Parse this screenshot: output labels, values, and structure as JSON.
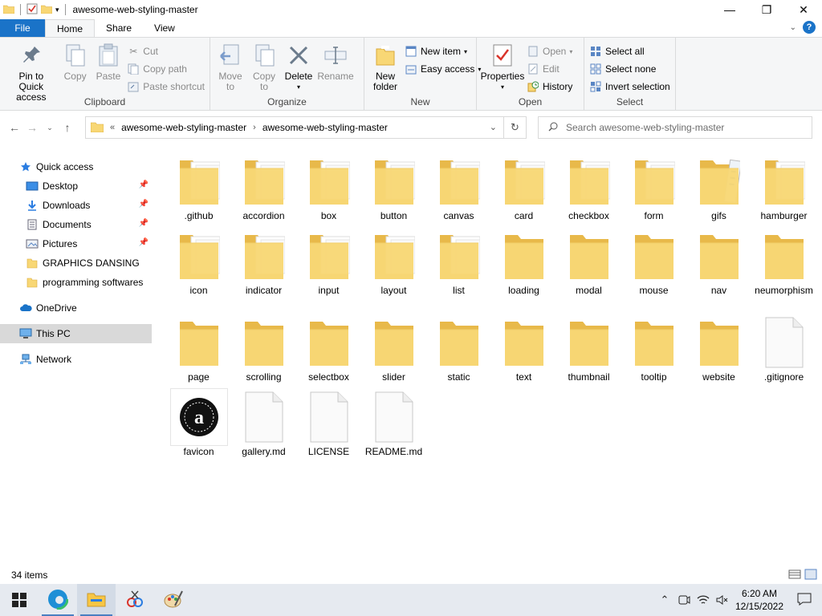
{
  "window": {
    "title": "awesome-web-styling-master",
    "minimize_glyph": "—",
    "maximize_glyph": "❐",
    "close_glyph": "✕"
  },
  "tabs": {
    "file": "File",
    "home": "Home",
    "share": "Share",
    "view": "View"
  },
  "ribbon": {
    "clipboard": {
      "label": "Clipboard",
      "pin": "Pin to Quick access",
      "copy": "Copy",
      "paste": "Paste",
      "cut": "Cut",
      "copy_path": "Copy path",
      "paste_shortcut": "Paste shortcut"
    },
    "organize": {
      "label": "Organize",
      "move_to": "Move to",
      "copy_to": "Copy to",
      "delete": "Delete",
      "rename": "Rename"
    },
    "new": {
      "label": "New",
      "new_folder": "New folder",
      "new_item": "New item",
      "easy_access": "Easy access"
    },
    "open": {
      "label": "Open",
      "properties": "Properties",
      "open": "Open",
      "edit": "Edit",
      "history": "History"
    },
    "select": {
      "label": "Select",
      "select_all": "Select all",
      "select_none": "Select none",
      "invert": "Invert selection"
    }
  },
  "address": {
    "prefix": "«",
    "crumbs": [
      "awesome-web-styling-master",
      "awesome-web-styling-master"
    ],
    "search_placeholder": "Search awesome-web-styling-master"
  },
  "sidebar": {
    "quick_access": "Quick access",
    "items": [
      "Desktop",
      "Downloads",
      "Documents",
      "Pictures",
      "GRAPHICS DANSING",
      "programming softwares"
    ],
    "onedrive": "OneDrive",
    "this_pc": "This PC",
    "network": "Network"
  },
  "files": [
    {
      "name": ".github",
      "kind": "folder-docs"
    },
    {
      "name": "accordion",
      "kind": "folder-docs"
    },
    {
      "name": "box",
      "kind": "folder-docs"
    },
    {
      "name": "button",
      "kind": "folder-docs"
    },
    {
      "name": "canvas",
      "kind": "folder-docs"
    },
    {
      "name": "card",
      "kind": "folder-docs"
    },
    {
      "name": "checkbox",
      "kind": "folder-docs"
    },
    {
      "name": "form",
      "kind": "folder-docs"
    },
    {
      "name": "gifs",
      "kind": "folder-img"
    },
    {
      "name": "hamburger",
      "kind": "folder-docs"
    },
    {
      "name": "icon",
      "kind": "folder-docs"
    },
    {
      "name": "indicator",
      "kind": "folder-docs"
    },
    {
      "name": "input",
      "kind": "folder-docs"
    },
    {
      "name": "layout",
      "kind": "folder-docs"
    },
    {
      "name": "list",
      "kind": "folder-docs"
    },
    {
      "name": "loading",
      "kind": "folder"
    },
    {
      "name": "modal",
      "kind": "folder"
    },
    {
      "name": "mouse",
      "kind": "folder"
    },
    {
      "name": "nav",
      "kind": "folder"
    },
    {
      "name": "neumorphism",
      "kind": "folder"
    },
    {
      "name": "page",
      "kind": "folder"
    },
    {
      "name": "scrolling",
      "kind": "folder"
    },
    {
      "name": "selectbox",
      "kind": "folder"
    },
    {
      "name": "slider",
      "kind": "folder"
    },
    {
      "name": "static",
      "kind": "folder"
    },
    {
      "name": "text",
      "kind": "folder"
    },
    {
      "name": "thumbnail",
      "kind": "folder"
    },
    {
      "name": "tooltip",
      "kind": "folder"
    },
    {
      "name": "website",
      "kind": "folder"
    },
    {
      "name": ".gitignore",
      "kind": "file"
    },
    {
      "name": "favicon",
      "kind": "favicon"
    },
    {
      "name": "gallery.md",
      "kind": "file"
    },
    {
      "name": "LICENSE",
      "kind": "file"
    },
    {
      "name": "README.md",
      "kind": "file"
    }
  ],
  "status": {
    "count": "34 items"
  },
  "taskbar": {
    "time": "6:20 AM",
    "date": "12/15/2022"
  },
  "colors": {
    "accent": "#1a73c8",
    "folder": "#f8d775",
    "folder_dark": "#e8b94a"
  }
}
